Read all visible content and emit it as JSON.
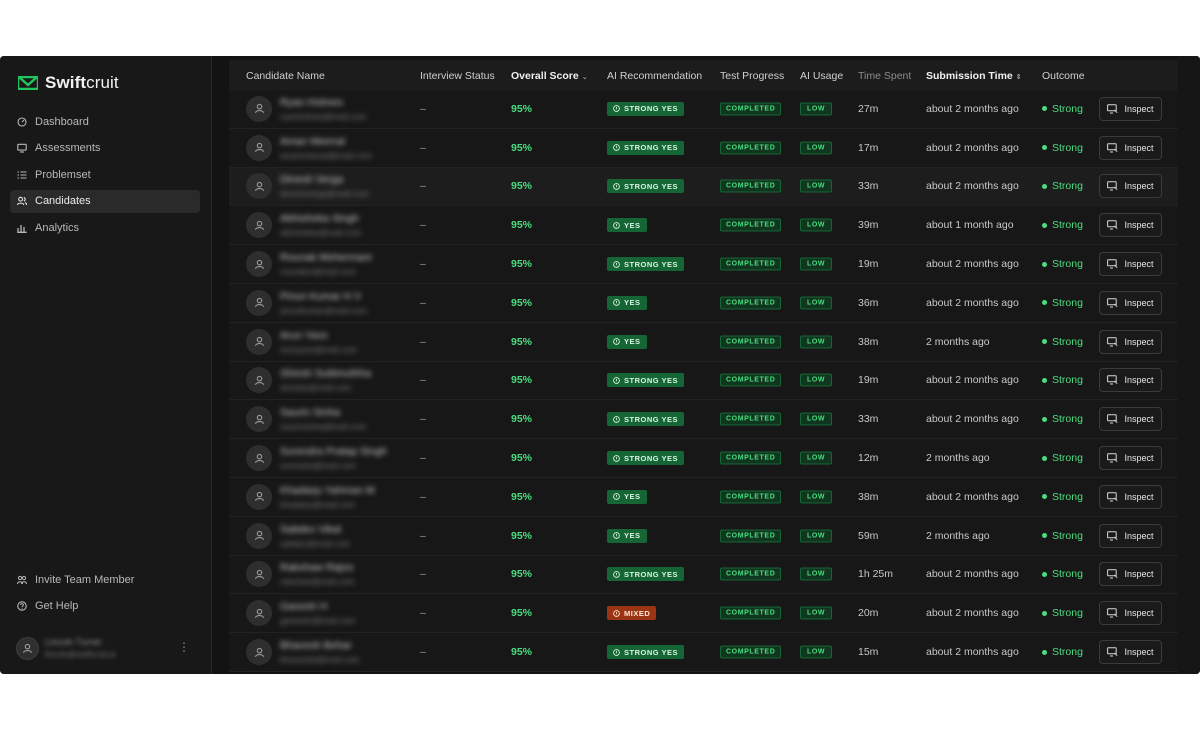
{
  "brand": {
    "name_bold": "Swift",
    "name_rest": "cruit",
    "accent": "#22c55e"
  },
  "nav": [
    {
      "label": "Dashboard",
      "icon": "dashboard-icon",
      "active": false
    },
    {
      "label": "Assessments",
      "icon": "monitor-icon",
      "active": false
    },
    {
      "label": "Problemset",
      "icon": "list-icon",
      "active": false
    },
    {
      "label": "Candidates",
      "icon": "users-icon",
      "active": true
    },
    {
      "label": "Analytics",
      "icon": "bar-chart-icon",
      "active": false
    }
  ],
  "bottom_nav": [
    {
      "label": "Invite Team Member",
      "icon": "invite-team-icon"
    },
    {
      "label": "Get Help",
      "icon": "help-icon"
    }
  ],
  "profile": {
    "name": "Lincoln Turner",
    "email": "lincoln@swiftcruit.ai"
  },
  "table": {
    "headers": {
      "candidate": "Candidate Name",
      "interview_status": "Interview Status",
      "overall_score": "Overall Score",
      "ai_recommendation": "AI Recommendation",
      "test_progress": "Test Progress",
      "ai_usage": "AI Usage",
      "time_spent": "Time Spent",
      "submission_time": "Submission Time",
      "outcome": "Outcome"
    },
    "inspect_label": "Inspect",
    "rows": [
      {
        "name": "Ryan Holmes",
        "email": "ryanholmes@mail.com",
        "status": "–",
        "score": "95%",
        "reco": "STRONG YES",
        "progress": "COMPLETED",
        "usage": "LOW",
        "time": "27m",
        "submitted": "about 2 months ago",
        "outcome": "Strong"
      },
      {
        "name": "Aman Meenal",
        "email": "amanmeenal@mail.com",
        "status": "–",
        "score": "95%",
        "reco": "STRONG YES",
        "progress": "COMPLETED",
        "usage": "LOW",
        "time": "17m",
        "submitted": "about 2 months ago",
        "outcome": "Strong"
      },
      {
        "name": "Dinesh Verga",
        "email": "dineshverga@mail.com",
        "status": "–",
        "score": "95%",
        "reco": "STRONG YES",
        "progress": "COMPLETED",
        "usage": "LOW",
        "time": "33m",
        "submitted": "about 2 months ago",
        "outcome": "Strong"
      },
      {
        "name": "Abhisheka Singh",
        "email": "abhisheka@mail.com",
        "status": "–",
        "score": "95%",
        "reco": "YES",
        "progress": "COMPLETED",
        "usage": "LOW",
        "time": "39m",
        "submitted": "about 1 month ago",
        "outcome": "Strong"
      },
      {
        "name": "Rounak Mehermani",
        "email": "rounakm@mail.com",
        "status": "–",
        "score": "95%",
        "reco": "STRONG YES",
        "progress": "COMPLETED",
        "usage": "LOW",
        "time": "19m",
        "submitted": "about 2 months ago",
        "outcome": "Strong"
      },
      {
        "name": "Pinun Kumar H V",
        "email": "pinunkumar@mail.com",
        "status": "–",
        "score": "95%",
        "reco": "YES",
        "progress": "COMPLETED",
        "usage": "LOW",
        "time": "36m",
        "submitted": "about 2 months ago",
        "outcome": "Strong"
      },
      {
        "name": "Arun Yavs",
        "email": "arunyavs@mail.com",
        "status": "–",
        "score": "95%",
        "reco": "YES",
        "progress": "COMPLETED",
        "usage": "LOW",
        "time": "38m",
        "submitted": "2 months ago",
        "outcome": "Strong"
      },
      {
        "name": "Shirish Suttimuthha",
        "email": "shirishs@mail.com",
        "status": "–",
        "score": "95%",
        "reco": "STRONG YES",
        "progress": "COMPLETED",
        "usage": "LOW",
        "time": "19m",
        "submitted": "about 2 months ago",
        "outcome": "Strong"
      },
      {
        "name": "Saurin Sinha",
        "email": "saurinsinha@mail.com",
        "status": "–",
        "score": "95%",
        "reco": "STRONG YES",
        "progress": "COMPLETED",
        "usage": "LOW",
        "time": "33m",
        "submitted": "about 2 months ago",
        "outcome": "Strong"
      },
      {
        "name": "Surendra Pratap Singh",
        "email": "surendra@mail.com",
        "status": "–",
        "score": "95%",
        "reco": "STRONG YES",
        "progress": "COMPLETED",
        "usage": "LOW",
        "time": "12m",
        "submitted": "2 months ago",
        "outcome": "Strong"
      },
      {
        "name": "Khadarju Yahman M",
        "email": "khadarju@mail.com",
        "status": "–",
        "score": "95%",
        "reco": "YES",
        "progress": "COMPLETED",
        "usage": "LOW",
        "time": "38m",
        "submitted": "about 2 months ago",
        "outcome": "Strong"
      },
      {
        "name": "Sabdev Vikal",
        "email": "sabdev@mail.com",
        "status": "–",
        "score": "95%",
        "reco": "YES",
        "progress": "COMPLETED",
        "usage": "LOW",
        "time": "59m",
        "submitted": "2 months ago",
        "outcome": "Strong"
      },
      {
        "name": "Rakshaw Rajoo",
        "email": "rakshaw@mail.com",
        "status": "–",
        "score": "95%",
        "reco": "STRONG YES",
        "progress": "COMPLETED",
        "usage": "LOW",
        "time": "1h 25m",
        "submitted": "about 2 months ago",
        "outcome": "Strong"
      },
      {
        "name": "Ganesh H",
        "email": "ganeshh@mail.com",
        "status": "–",
        "score": "95%",
        "reco": "MIXED",
        "progress": "COMPLETED",
        "usage": "LOW",
        "time": "20m",
        "submitted": "about 2 months ago",
        "outcome": "Strong"
      },
      {
        "name": "Bhavesh Behar",
        "email": "bhaveshb@mail.com",
        "status": "–",
        "score": "95%",
        "reco": "STRONG YES",
        "progress": "COMPLETED",
        "usage": "LOW",
        "time": "15m",
        "submitted": "about 2 months ago",
        "outcome": "Strong"
      }
    ]
  }
}
